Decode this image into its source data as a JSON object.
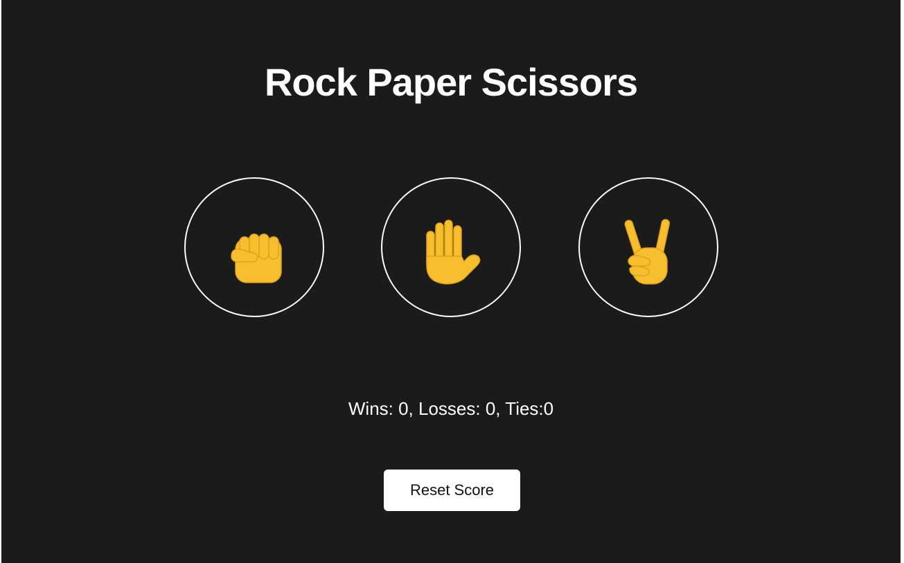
{
  "title": "Rock Paper Scissors",
  "choices": [
    {
      "name": "rock",
      "icon": "raised-fist-icon"
    },
    {
      "name": "paper",
      "icon": "raised-hand-icon"
    },
    {
      "name": "scissors",
      "icon": "victory-hand-icon"
    }
  ],
  "score": {
    "text": "Wins: 0, Losses: 0, Ties:0"
  },
  "reset_label": "Reset Score",
  "colors": {
    "background": "#1b1b1b",
    "emoji": "#f7bf2f",
    "emoji_outline": "#e0a316"
  }
}
